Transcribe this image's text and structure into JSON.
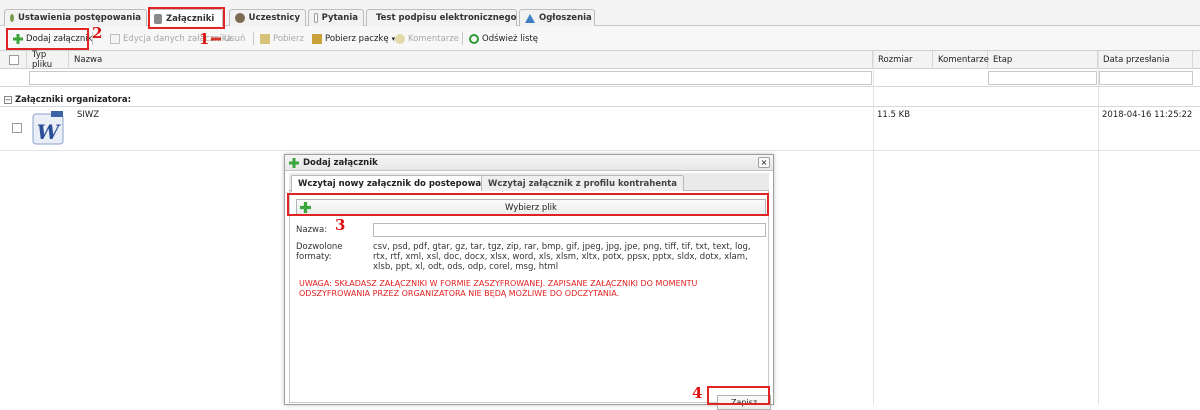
{
  "tabs": [
    {
      "label": "Ustawienia postępowania",
      "icon": "settings-icon"
    },
    {
      "label": "Załączniki",
      "icon": "attachment-icon",
      "active": true
    },
    {
      "label": "Uczestnicy",
      "icon": "users-icon"
    },
    {
      "label": "Pytania",
      "icon": "question-icon"
    },
    {
      "label": "Test podpisu elektronicznego",
      "icon": "lock-icon"
    },
    {
      "label": "Ogłoszenia",
      "icon": "announcement-icon"
    }
  ],
  "toolbar": {
    "add": "Dodaj załącznik",
    "edit": "Edycja danych załącznika",
    "delete": "Usuń",
    "download": "Pobierz",
    "download_package": "Pobierz paczkę",
    "comments": "Komentarze",
    "refresh": "Odśwież listę"
  },
  "grid": {
    "columns": [
      "Typ pliku",
      "Nazwa",
      "Rozmiar",
      "Komentarze",
      "Etap",
      "Data przesłania"
    ],
    "group_label": "Załączniki organizatora:",
    "rows": [
      {
        "icon": "word-doc-icon",
        "name": "SIWZ",
        "size": "11.5 KB",
        "date": "2018-04-16 11:25:22"
      }
    ]
  },
  "dialog": {
    "title": "Dodaj załącznik",
    "close": "×",
    "tabs": [
      "Wczytaj nowy załącznik do postepowania",
      "Wczytaj załącznik z profilu kontrahenta"
    ],
    "choose_file": "Wybierz plik",
    "name_label": "Nazwa:",
    "name_value": "",
    "formats_label_1": "Dozwolone",
    "formats_label_2": "formaty:",
    "formats": "csv, psd, pdf, gtar, gz, tar, tgz, zip, rar, bmp, gif, jpeg, jpg, jpe, png, tiff, tif, txt, text, log, rtx, rtf, xml, xsl, doc, docx, xlsx, word, xls, xlsm, xltx, potx, ppsx, pptx, sldx, dotx, xlam, xlsb, ppt, xl, odt, ods, odp, corel, msg, html",
    "warning": "UWAGA: SKŁADASZ ZAŁĄCZNIKI W FORMIE ZASZYFROWANEJ. ZAPISANE ZAŁĄCZNIKI DO MOMENTU ODSZYFROWANIA PRZEZ ORGANIZATORA NIE BĘDĄ MOŻLIWE DO ODCZYTANIA.",
    "save": "Zapisz"
  },
  "annotations": [
    "1",
    "2",
    "3",
    "4"
  ],
  "colors": {
    "annotation": "#e02424",
    "warning": "#e02020",
    "add_icon": "#3aa53a"
  }
}
